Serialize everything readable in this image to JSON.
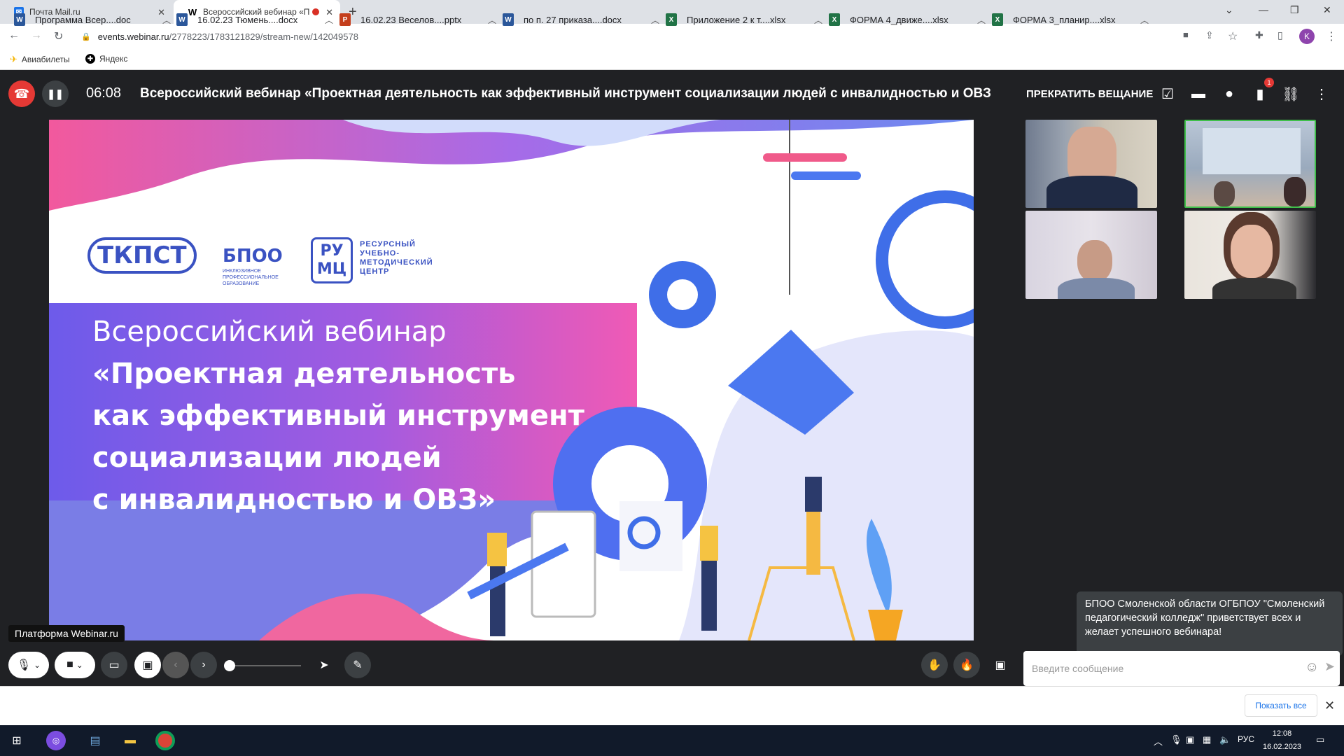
{
  "browser": {
    "tabs": [
      {
        "title": "Почта Mail.ru",
        "favicon": "mail-icon"
      },
      {
        "title": "Всероссийский вебинар «П",
        "favicon": "webinar-icon",
        "recording": true
      }
    ],
    "url_domain": "events.webinar.ru",
    "url_path": "/2778223/1783121829/stream-new/142049578",
    "profile_initial": "K",
    "bookmarks": [
      "Авиабилеты",
      "Яндекс"
    ]
  },
  "webinar": {
    "timer": "06:08",
    "title": "Всероссийский вебинар «Проектная деятельность как эффективный инструмент социализации людей с инвалидностью и ОВЗ",
    "stop_broadcast": "ПРЕКРАТИТЬ ВЕЩАНИЕ",
    "notification_count": "1",
    "slide": {
      "logos": {
        "tkpst": "ТКПСТ",
        "bpoo": "БПОО",
        "bpoo_sub": "ИНКЛЮЗИВНОЕ ПРОФЕССИОНАЛЬНОЕ ОБРАЗОВАНИЕ",
        "rumc": "РУ МЦ",
        "rumc_sub": "РЕСУРСНЫЙ УЧЕБНО- МЕТОДИЧЕСКИЙ ЦЕНТР"
      },
      "line1": "Всероссийский вебинар",
      "line2": "«Проектная деятельность",
      "line3": "как эффективный инструмент",
      "line4": "социализации людей",
      "line5": "с инвалидностью и ОВЗ»"
    },
    "platform_tooltip": "Платформа Webinar.ru",
    "chat_message": "БПОО Смоленской области ОГБПОУ \"Смоленский педагогический колледж\" приветствует всех и желает успешного вебинара!",
    "chat_placeholder": "Введите сообщение"
  },
  "downloads": {
    "items": [
      {
        "name": "Программа Всер....doc",
        "type": "word"
      },
      {
        "name": "16.02.23 Тюмень....docx",
        "type": "word"
      },
      {
        "name": "16.02.23 Веселов....pptx",
        "type": "ppt"
      },
      {
        "name": "по п. 27 приказа....docx",
        "type": "word"
      },
      {
        "name": "Приложение 2 к т....xlsx",
        "type": "excel"
      },
      {
        "name": "ФОРМА 4_движе....xlsx",
        "type": "excel"
      },
      {
        "name": "ФОРМА 3_планир....xlsx",
        "type": "excel"
      }
    ],
    "show_all": "Показать все"
  },
  "taskbar": {
    "lang": "РУС",
    "time": "12:08",
    "date": "16.02.2023"
  }
}
